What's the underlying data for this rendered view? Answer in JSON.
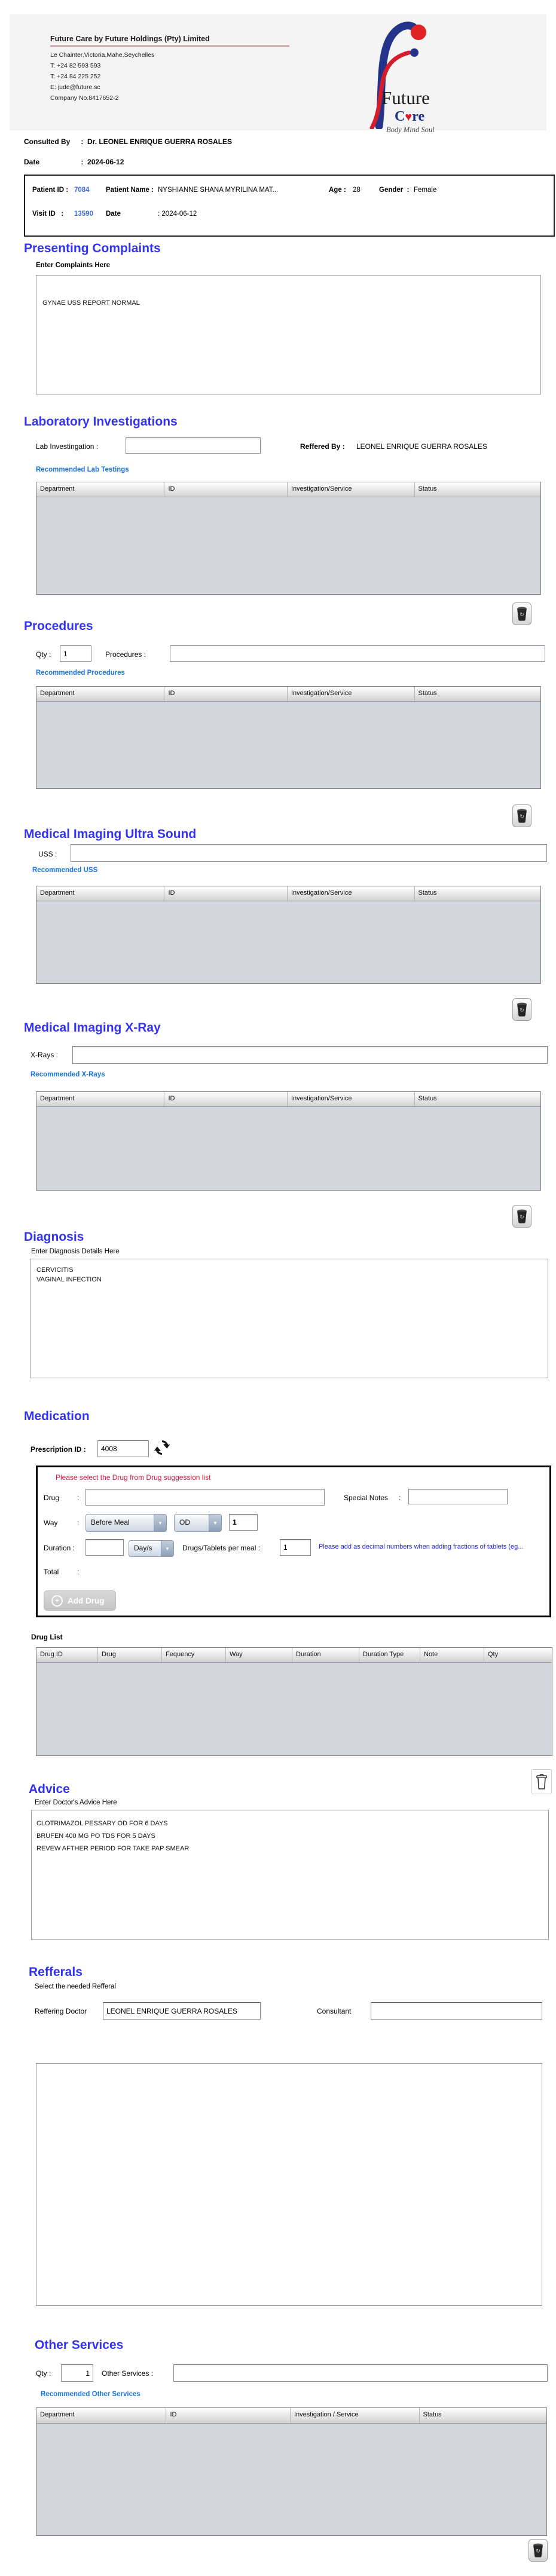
{
  "misc": {
    "colon": ":"
  },
  "letterhead": {
    "company": "Future Care by Future Holdings (Pty) Limited",
    "address_lines": [
      "Le Chainter,Victoria,Mahe,Seychelles",
      "T: +24  82 593 593",
      "T: +24  84 225 252",
      "E: jude@future.sc",
      "Company No.8417652-2"
    ],
    "logo": {
      "title": "Future",
      "care_c": "C",
      "care_heart": "♥",
      "care_rest": "re",
      "tagline": "Body Mind Soul"
    }
  },
  "consultation": {
    "consulted_by_label": "Consulted By",
    "consulted_by_value": "Dr.  LEONEL ENRIQUE GUERRA ROSALES",
    "date_label": "Date",
    "date_value": "2024-06-12"
  },
  "patient": {
    "patient_id_label": "Patient ID",
    "patient_id": "7084",
    "patient_name_label": "Patient Name",
    "patient_name": "NYSHIANNE SHANA MYRILINA MAT...",
    "age_label": "Age",
    "age": "28",
    "gender_label": "Gender",
    "gender": "Female",
    "visit_id_label": "Visit ID",
    "visit_id": "13590",
    "visit_date_label": "Date",
    "visit_date": "2024-06-12"
  },
  "presenting_complaints": {
    "title": "Presenting Complaints",
    "label": "Enter Complaints Here",
    "value": "GYNAE USS REPORT NORMAL"
  },
  "laboratory": {
    "title": "Laboratory  Investigations",
    "lab_label": "Lab Investingation :",
    "lab_value": "",
    "referred_by_label": "Reffered By :",
    "referred_by_value": "LEONEL ENRIQUE GUERRA ROSALES",
    "recommended_link": "Recommended Lab Testings",
    "headers": [
      "Department",
      "ID",
      "Investigation/Service",
      "Status"
    ]
  },
  "procedures": {
    "title": "Procedures",
    "qty_label": "Qty :",
    "qty_value": "1",
    "procedures_label": "Procedures :",
    "procedures_value": "",
    "recommended_link": "Recommended Procedures",
    "headers": [
      "Department",
      "ID",
      "Investigation/Service",
      "Status"
    ]
  },
  "ultrasound": {
    "title": "Medical Imaging Ultra Sound",
    "uss_label": "USS :",
    "uss_value": "",
    "recommended_link": "Recommended USS",
    "headers": [
      "Department",
      "ID",
      "Investigation/Service",
      "Status"
    ]
  },
  "xray": {
    "title": "Medical Imaging X-Ray",
    "xray_label": "X-Rays :",
    "xray_value": "",
    "recommended_link": "Recommended X-Rays",
    "headers": [
      "Department",
      "ID",
      "Investigation/Service",
      "Status"
    ]
  },
  "diagnosis": {
    "title": "Diagnosis",
    "label": "Enter Diagnosis Details Here",
    "value": "CERVICITIS\nVAGINAL INFECTION"
  },
  "medication": {
    "title": "Medication",
    "prescription_id_label": "Prescription ID :",
    "prescription_id": "4008",
    "drug_suggestion_note": "Please select the Drug from Drug suggession list",
    "drug_label": "Drug",
    "drug_value": "",
    "special_notes_label": "Special Notes",
    "special_notes_value": "",
    "way_label": "Way",
    "meal_option": "Before Meal",
    "frequency_option": "OD",
    "way_qty": "1",
    "duration_label": "Duration :",
    "duration_value": "",
    "duration_unit": "Day/s",
    "per_meal_label": "Drugs/Tablets per meal :",
    "per_meal_value": "1",
    "fraction_note": "Please add as decimal numbers when adding fractions of tablets (eg...",
    "total_label": "Total",
    "add_drug_label": "Add Drug"
  },
  "drug_list": {
    "title": "Drug List",
    "headers": [
      "Drug ID",
      "Drug",
      "Fequency",
      "Way",
      "Duration",
      "Duration Type",
      "Note",
      "Qty"
    ]
  },
  "advice": {
    "title": "Advice",
    "label": "Enter Doctor's Advice Here",
    "value": "CLOTRIMAZOL PESSARY OD FOR 6 DAYS\nBRUFEN 400 MG PO TDS FOR 5 DAYS\nREVEW AFTHER PERIOD FOR TAKE PAP SMEAR"
  },
  "referrals": {
    "title": "Refferals",
    "subtitle": "Select the needed Refferal",
    "referring_doctor_label": "Reffering Doctor",
    "referring_doctor_value": "LEONEL ENRIQUE GUERRA ROSALES",
    "consultant_label": "Consultant",
    "consultant_value": ""
  },
  "other_services": {
    "title": "Other Services",
    "qty_label": "Qty :",
    "qty_value": "1",
    "services_label": "Other Services :",
    "services_value": "",
    "recommended_link": "Recommended Other Services",
    "headers": [
      "Department",
      "ID",
      "Investigation / Service",
      "Status"
    ]
  },
  "icons": {
    "dropdown_glyph": "▼",
    "plus_glyph": "+",
    "trash_refresh_glyph": "↻"
  },
  "colors": {
    "heading_blue": "#3333f0",
    "link_blue": "#1874e8",
    "id_blue": "#4169e1",
    "note_red": "#dc1446",
    "note_blue": "#2222dd",
    "table_body": "#d4d7de"
  }
}
